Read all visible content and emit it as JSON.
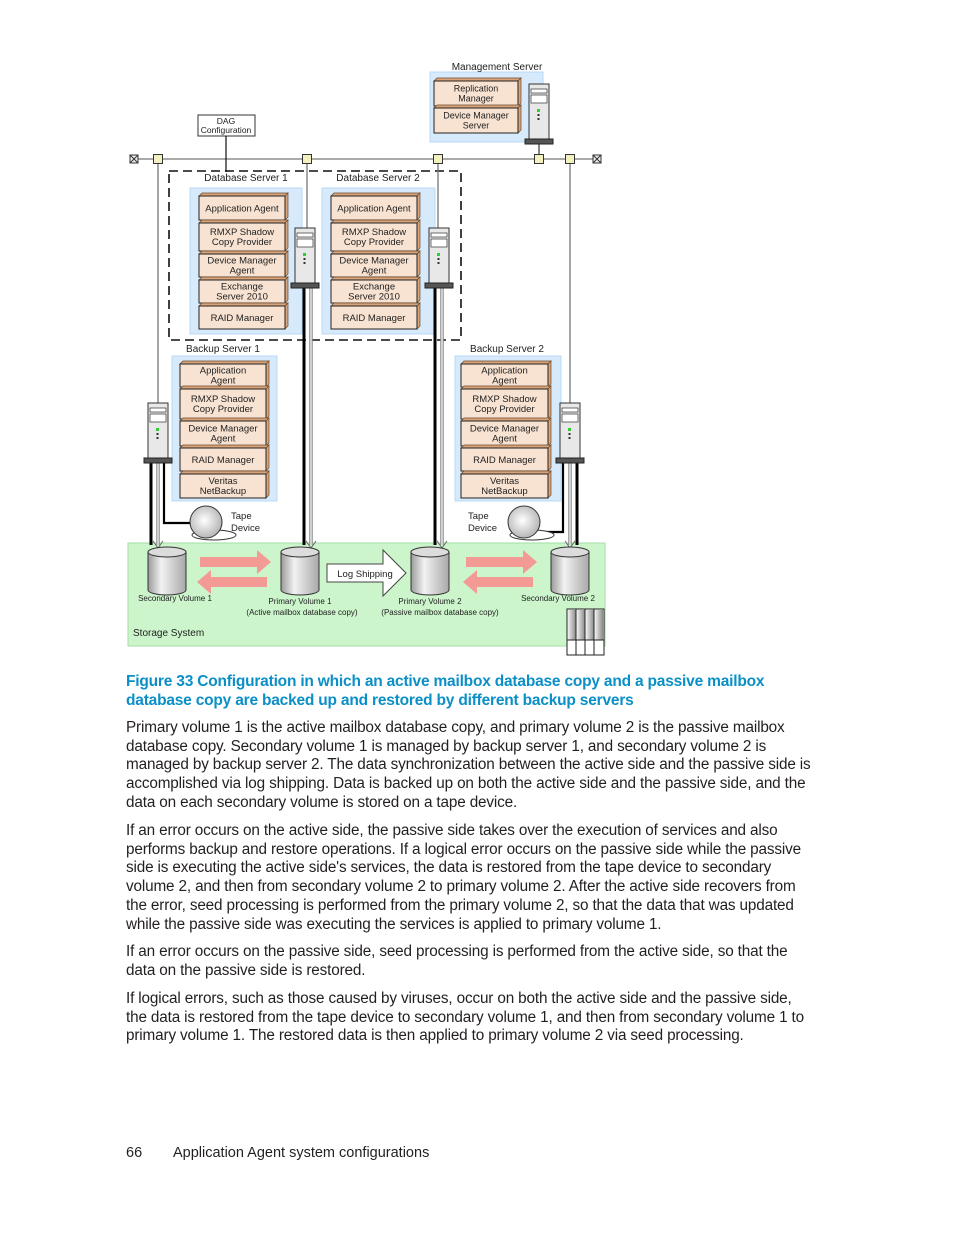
{
  "diagram": {
    "management_server": {
      "label": "Management Server",
      "components": [
        [
          "Replication",
          "Manager"
        ],
        [
          "Device Manager",
          "Server"
        ]
      ]
    },
    "dag_configuration": [
      "DAG",
      "Configuration"
    ],
    "database_servers": [
      {
        "label": "Database Server 1",
        "components": [
          [
            "Application Agent"
          ],
          [
            "RMXP Shadow",
            "Copy Provider"
          ],
          [
            "Device Manager",
            "Agent"
          ],
          [
            "Exchange",
            "Server 2010"
          ],
          [
            "RAID Manager"
          ]
        ]
      },
      {
        "label": "Database Server 2",
        "components": [
          [
            "Application Agent"
          ],
          [
            "RMXP Shadow",
            "Copy Provider"
          ],
          [
            "Device Manager",
            "Agent"
          ],
          [
            "Exchange",
            "Server 2010"
          ],
          [
            "RAID Manager"
          ]
        ]
      }
    ],
    "backup_servers": [
      {
        "label": "Backup Server 1",
        "components": [
          [
            "Application",
            "Agent"
          ],
          [
            "RMXP Shadow",
            "Copy Provider"
          ],
          [
            "Device Manager",
            "Agent"
          ],
          [
            "RAID Manager"
          ],
          [
            "Veritas",
            "NetBackup"
          ]
        ]
      },
      {
        "label": "Backup Server 2",
        "components": [
          [
            "Application",
            "Agent"
          ],
          [
            "RMXP Shadow",
            "Copy Provider"
          ],
          [
            "Device Manager",
            "Agent"
          ],
          [
            "RAID Manager"
          ],
          [
            "Veritas",
            "NetBackup"
          ]
        ]
      }
    ],
    "tape_devices": [
      [
        "Tape",
        "Device"
      ],
      [
        "Tape",
        "Device"
      ]
    ],
    "storage_system": {
      "label": "Storage System",
      "volumes": [
        {
          "name": "Secondary Volume 1",
          "note": ""
        },
        {
          "name": "Primary Volume 1",
          "note": "(Active mailbox database copy)"
        },
        {
          "name": "Primary Volume 2",
          "note": "(Passive mailbox database copy)"
        },
        {
          "name": "Secondary Volume 2",
          "note": ""
        }
      ],
      "log_shipping_label": "Log Shipping"
    },
    "colors": {
      "server_panel": "#d6eafb",
      "component_fill": "#f8e3d2",
      "component_side": "#d9a47a",
      "storage_fill": "#ccf5cc",
      "copy_arrow": "#f49a94",
      "network_node": "#f4f1c0"
    }
  },
  "caption": "Figure 33 Configuration in which an active mailbox database copy and a passive mailbox database copy are backed up and restored by different backup servers",
  "paragraphs": [
    "Primary volume 1 is the active mailbox database copy, and primary volume 2 is the passive mailbox database copy. Secondary volume 1 is managed by backup server 1, and secondary volume 2 is managed by backup server 2. The data synchronization between the active side and the passive side is accomplished via log shipping. Data is backed up on both the active side and the passive side, and the data on each secondary volume is stored on a tape device.",
    "If an error occurs on the active side, the passive side takes over the execution of services and also performs backup and restore operations. If a logical error occurs on the passive side while the passive side is executing the active side's services, the data is restored from the tape device to secondary volume 2, and then from secondary volume 2 to primary volume 2. After the active side recovers from the error, seed processing is performed from the primary volume 2, so that the data that was updated while the passive side was executing the services is applied to primary volume 1.",
    "If an error occurs on the passive side, seed processing is performed from the active side, so that the data on the passive side is restored.",
    "If logical errors, such as those caused by viruses, occur on both the active side and the passive side, the data is restored from the tape device to secondary volume 1, and then from secondary volume 1 to primary volume 1. The restored data is then applied to primary volume 2 via seed processing."
  ],
  "footer": {
    "page_number": "66",
    "section_title": "Application Agent system configurations"
  }
}
